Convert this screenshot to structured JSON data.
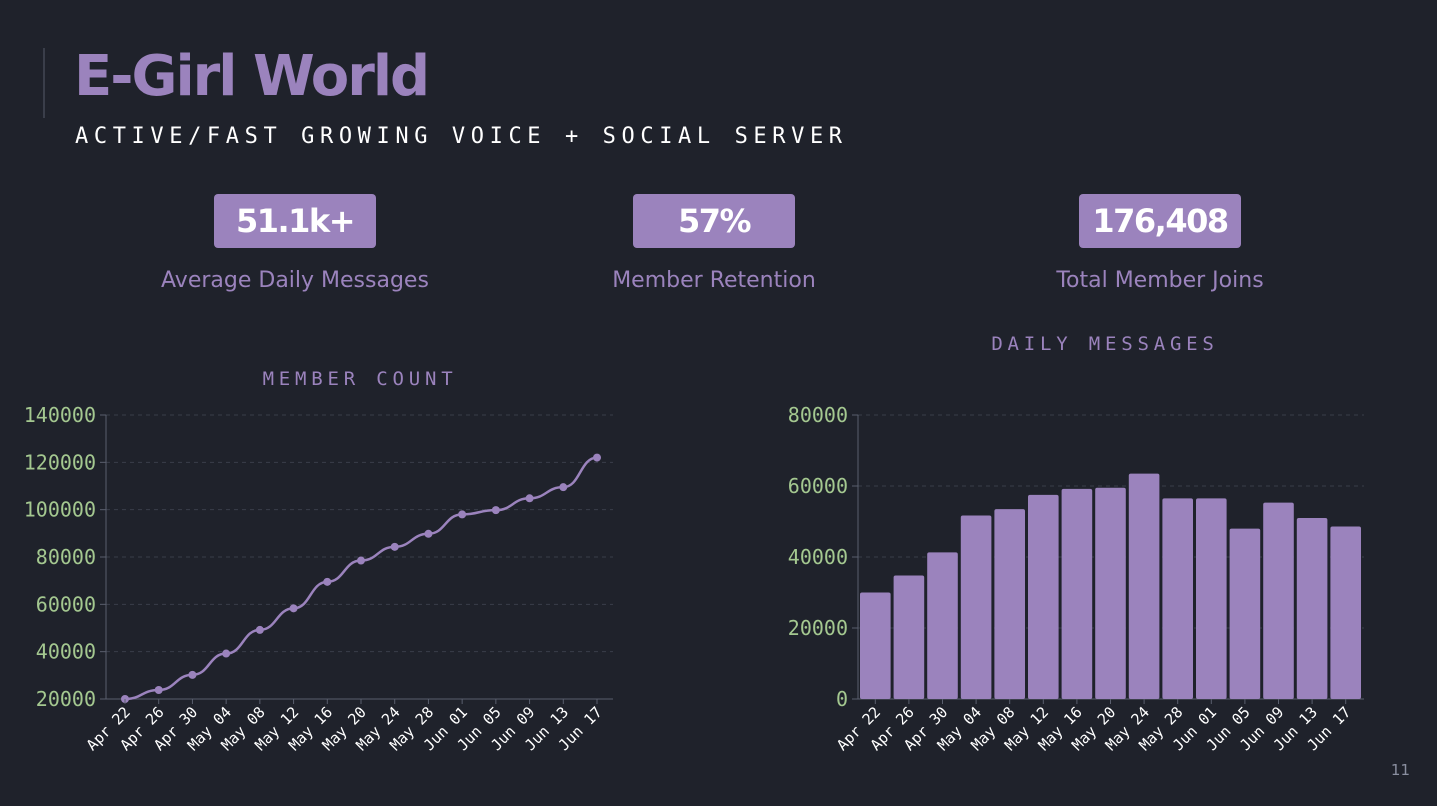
{
  "header": {
    "title": "E-Girl World",
    "subtitle": "ACTIVE/FAST GROWING VOICE + SOCIAL SERVER"
  },
  "stats": [
    {
      "value": "51.1k+",
      "label": "Average Daily Messages"
    },
    {
      "value": "57%",
      "label": "Member Retention"
    },
    {
      "value": "176,408",
      "label": "Total Member Joins"
    }
  ],
  "page_number": "11",
  "colors": {
    "background": "#1f222b",
    "accent": "#9b83bd",
    "tick_y": "#a4c890",
    "grid": "#3a3e4a"
  },
  "chart_data": [
    {
      "type": "line",
      "title": "MEMBER COUNT",
      "categories": [
        "Apr 22",
        "Apr 26",
        "Apr 30",
        "May 04",
        "May 08",
        "May 12",
        "May 16",
        "May 20",
        "May 24",
        "May 28",
        "Jun 01",
        "Jun 05",
        "Jun 09",
        "Jun 13",
        "Jun 17"
      ],
      "values": [
        20000,
        23800,
        30200,
        39200,
        49200,
        58300,
        69500,
        78500,
        84300,
        89800,
        98000,
        99800,
        104800,
        109500,
        122000
      ],
      "ylim": [
        20000,
        140000
      ],
      "yticks": [
        20000,
        40000,
        60000,
        80000,
        100000,
        120000,
        140000
      ],
      "grid": true,
      "xlabel": "",
      "ylabel": ""
    },
    {
      "type": "bar",
      "title": "DAILY MESSAGES",
      "categories": [
        "Apr 22",
        "Apr 26",
        "Apr 30",
        "May 04",
        "May 08",
        "May 12",
        "May 16",
        "May 20",
        "May 24",
        "May 28",
        "Jun 01",
        "Jun 05",
        "Jun 09",
        "Jun 13",
        "Jun 17"
      ],
      "values": [
        30000,
        34800,
        41300,
        51700,
        53500,
        57500,
        59200,
        59500,
        63500,
        56500,
        56500,
        48000,
        55300,
        51000,
        48600
      ],
      "ylim": [
        0,
        80000
      ],
      "yticks": [
        0,
        20000,
        40000,
        60000,
        80000
      ],
      "grid": true,
      "xlabel": "",
      "ylabel": ""
    }
  ]
}
